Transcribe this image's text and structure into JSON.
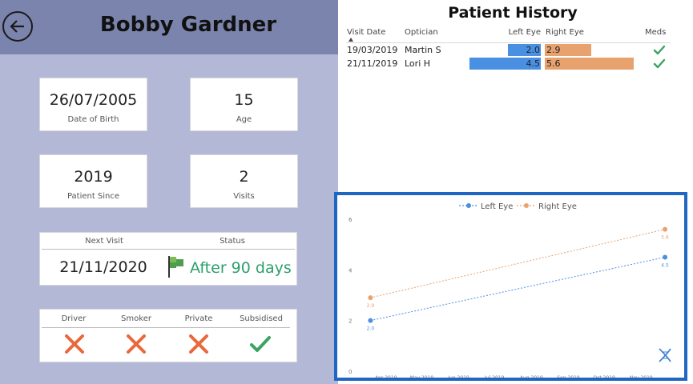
{
  "patient": {
    "name": "Bobby Gardner",
    "dob": "26/07/2005",
    "dob_label": "Date of Birth",
    "age": "15",
    "age_label": "Age",
    "since": "2019",
    "since_label": "Patient Since",
    "visits": "2",
    "visits_label": "Visits",
    "next_visit_label": "Next Visit",
    "next_visit": "21/11/2020",
    "status_label": "Status",
    "status": "After 90 days",
    "flags": [
      {
        "label": "Driver",
        "icon": "cross-icon"
      },
      {
        "label": "Smoker",
        "icon": "cross-icon"
      },
      {
        "label": "Private",
        "icon": "cross-icon"
      },
      {
        "label": "Subsidised",
        "icon": "check-icon"
      }
    ]
  },
  "history": {
    "title": "Patient History",
    "columns": [
      "Visit Date",
      "Optician",
      "Left Eye",
      "Right Eye",
      "Meds"
    ],
    "rows": [
      {
        "date": "19/03/2019",
        "optician": "Martin S",
        "left": "2.0",
        "right": "2.9",
        "meds": "check-icon"
      },
      {
        "date": "21/11/2019",
        "optician": "Lori H",
        "left": "4.5",
        "right": "5.6",
        "meds": "check-icon"
      }
    ]
  },
  "colors": {
    "left_eye": "#4a90e2",
    "right_eye": "#e8a26e",
    "frame": "#1f66c2",
    "status_green": "#2e9f6e",
    "cross": "#e8693c",
    "check": "#3aa35f"
  },
  "chart_data": {
    "type": "line",
    "series": [
      {
        "name": "Left Eye",
        "x": [
          "2019-03-19",
          "2019-11-21"
        ],
        "values": [
          2.0,
          4.5
        ],
        "labels": [
          "2.0",
          "4.5"
        ]
      },
      {
        "name": "Right Eye",
        "x": [
          "2019-03-19",
          "2019-11-21"
        ],
        "values": [
          2.9,
          5.6
        ],
        "labels": [
          "2.9",
          "5.6"
        ]
      }
    ],
    "x_ticks": [
      "Apr 2019",
      "May 2019",
      "Jun 2019",
      "Jul 2019",
      "Aug 2019",
      "Sep 2019",
      "Oct 2019",
      "Nov 2019"
    ],
    "y_ticks": [
      "0",
      "2",
      "4",
      "6"
    ],
    "ylim": [
      0,
      6
    ],
    "xlim": [
      "2019-03-10",
      "2019-11-27"
    ],
    "legend": "top-center",
    "grid": false
  }
}
